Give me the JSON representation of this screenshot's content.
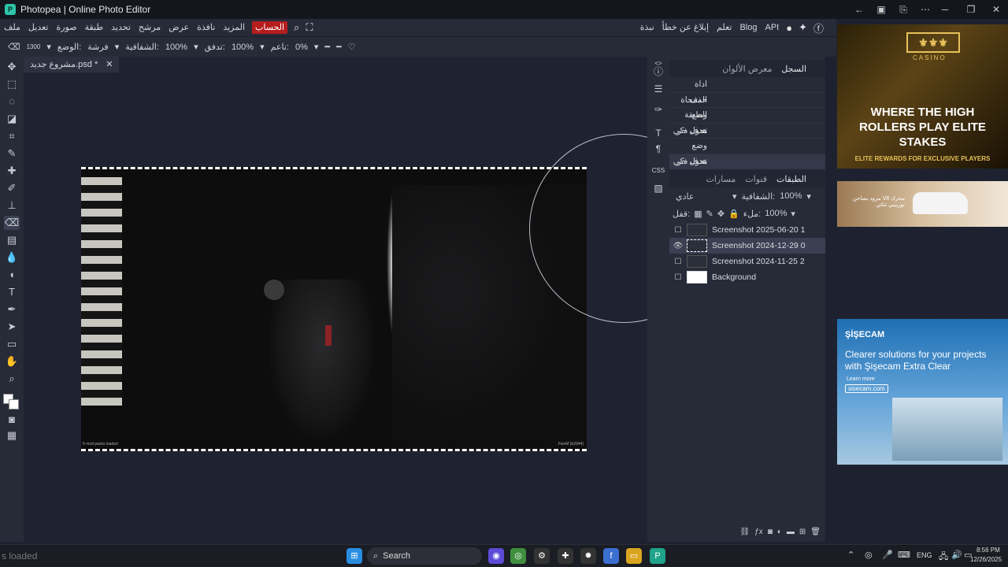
{
  "window": {
    "title": "Photopea | Online Photo Editor",
    "app_icon": "photopea-icon",
    "controls": [
      "─",
      "❐",
      "✕"
    ]
  },
  "menu": {
    "items": [
      "ملف",
      "تعديل",
      "صورة",
      "طبقة",
      "تحديد",
      "مرشح",
      "عرض",
      "نافذة",
      "المزيد",
      "الحساب"
    ],
    "right_items": [
      "API",
      "Blog",
      "تعلم",
      "إبلاغ عن خطأ",
      "نبذة"
    ]
  },
  "options": {
    "brush_size": "1300",
    "brush_label": "فرشة",
    "mode_label": "الوضع:",
    "opacity_label": "الشفافية:",
    "opacity_value": "100%",
    "flow_label": "تدفق:",
    "flow_value": "100%",
    "smooth_label": "ناعم:",
    "smooth_value": "0%"
  },
  "document": {
    "tab_label": "مشروع جديد.psd *",
    "close": "✕",
    "canvas_footer_left": "5 mod packs loaded",
    "canvas_footer_right": "FiveM (b2944)"
  },
  "history_panel": {
    "tabs": [
      "معرض الألوان",
      "السجل"
    ],
    "entries": [
      "اداة الممحاة",
      "حذف الطبقة",
      "وضع هدف ذكي",
      "تحول حر",
      "وضع هدف ذكي",
      "تحول حر"
    ]
  },
  "layers_panel": {
    "tabs": [
      "مسارات",
      "قنوات",
      "الطبقات"
    ],
    "blend_mode": "عادي",
    "opacity_label": "الشفافية:",
    "opacity_value": "100%",
    "lock_label": "قفل:",
    "fill_label": "ملء:",
    "fill_value": "100%",
    "layers": [
      {
        "name": "Screenshot 2025-06-20 1",
        "visible": false,
        "selected": false
      },
      {
        "name": "Screenshot 2024-12-29 0",
        "visible": true,
        "selected": true
      },
      {
        "name": "Screenshot 2024-11-25 2",
        "visible": false,
        "selected": false
      },
      {
        "name": "Background",
        "visible": false,
        "selected": false
      }
    ]
  },
  "ads": {
    "casino_title": "WHERE THE HIGH ROLLERS PLAY ELITE STAKES",
    "casino_sub": "ELITE REWARDS FOR EXCLUSIVE PLAYERS",
    "casino_brand": "CASINO",
    "car_text": "محرك V8 مزود بشاحن توربيني ثنائي",
    "sisecam_brand": "ŞİŞECAM",
    "sisecam_text": "Clearer solutions for your projects with Şişecam Extra Clear",
    "sisecam_learn": "Learn more",
    "sisecam_url": "sisecam.com"
  },
  "taskbar": {
    "status_left": "s loaded",
    "search_placeholder": "Search",
    "lang": "ENG",
    "time": "8:56 PM",
    "date": "12/26/2025"
  }
}
